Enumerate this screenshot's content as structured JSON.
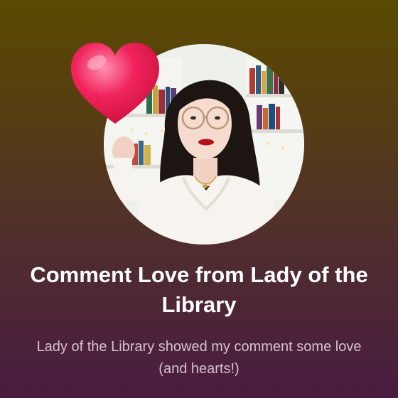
{
  "notification": {
    "title": "Comment Love from Lady of the Library",
    "subtitle": "Lady of the Library showed my comment some love (and hearts!)"
  },
  "colors": {
    "background_top": "#5a4a00",
    "background_bottom": "#4a1c40",
    "heart": "#f0245c",
    "title_text": "#ffffff",
    "subtitle_text": "#d7c2cf"
  },
  "icons": {
    "heart": "heart-icon"
  }
}
